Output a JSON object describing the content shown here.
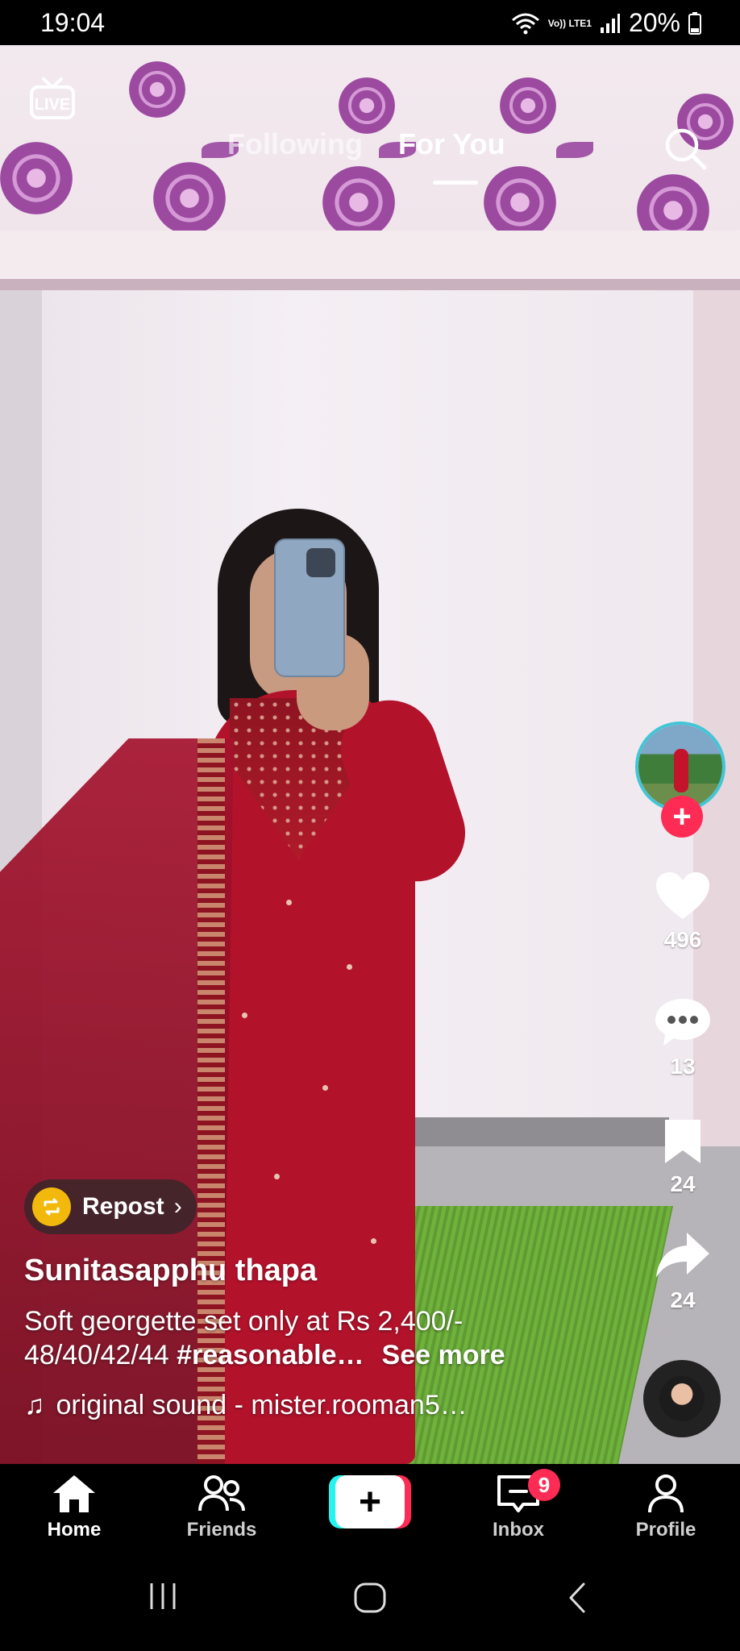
{
  "status_bar": {
    "time": "19:04",
    "network": "Vo)) LTE1",
    "battery": "20%"
  },
  "top_nav": {
    "live_label": "LIVE",
    "tabs": [
      {
        "label": "Following",
        "active": false
      },
      {
        "label": "For You",
        "active": true
      }
    ],
    "search_icon": "search-icon"
  },
  "right_rail": {
    "avatar_icon": "creator-avatar",
    "follow_icon": "plus-icon",
    "likes": "496",
    "comments": "13",
    "favorites": "24",
    "shares": "24",
    "music_disc_icon": "music-disc"
  },
  "caption": {
    "repost_label": "Repost",
    "username": "Sunitasapphu thapa",
    "description_line1": "Soft georgette set only at Rs 2,400/-",
    "description_line2_prefix": "48/40/42/44 ",
    "hashtag": "#reasonable…",
    "see_more": "See more",
    "sound": "original sound - mister.rooman5…"
  },
  "bottom_nav": {
    "items": [
      {
        "label": "Home",
        "active": true
      },
      {
        "label": "Friends",
        "active": false
      },
      {
        "label": "Inbox",
        "active": false,
        "badge": "9"
      },
      {
        "label": "Profile",
        "active": false
      }
    ]
  },
  "colors": {
    "accent_red": "#fe2c55",
    "accent_cyan": "#25f4ee",
    "repost_yellow": "#f2b90c"
  }
}
